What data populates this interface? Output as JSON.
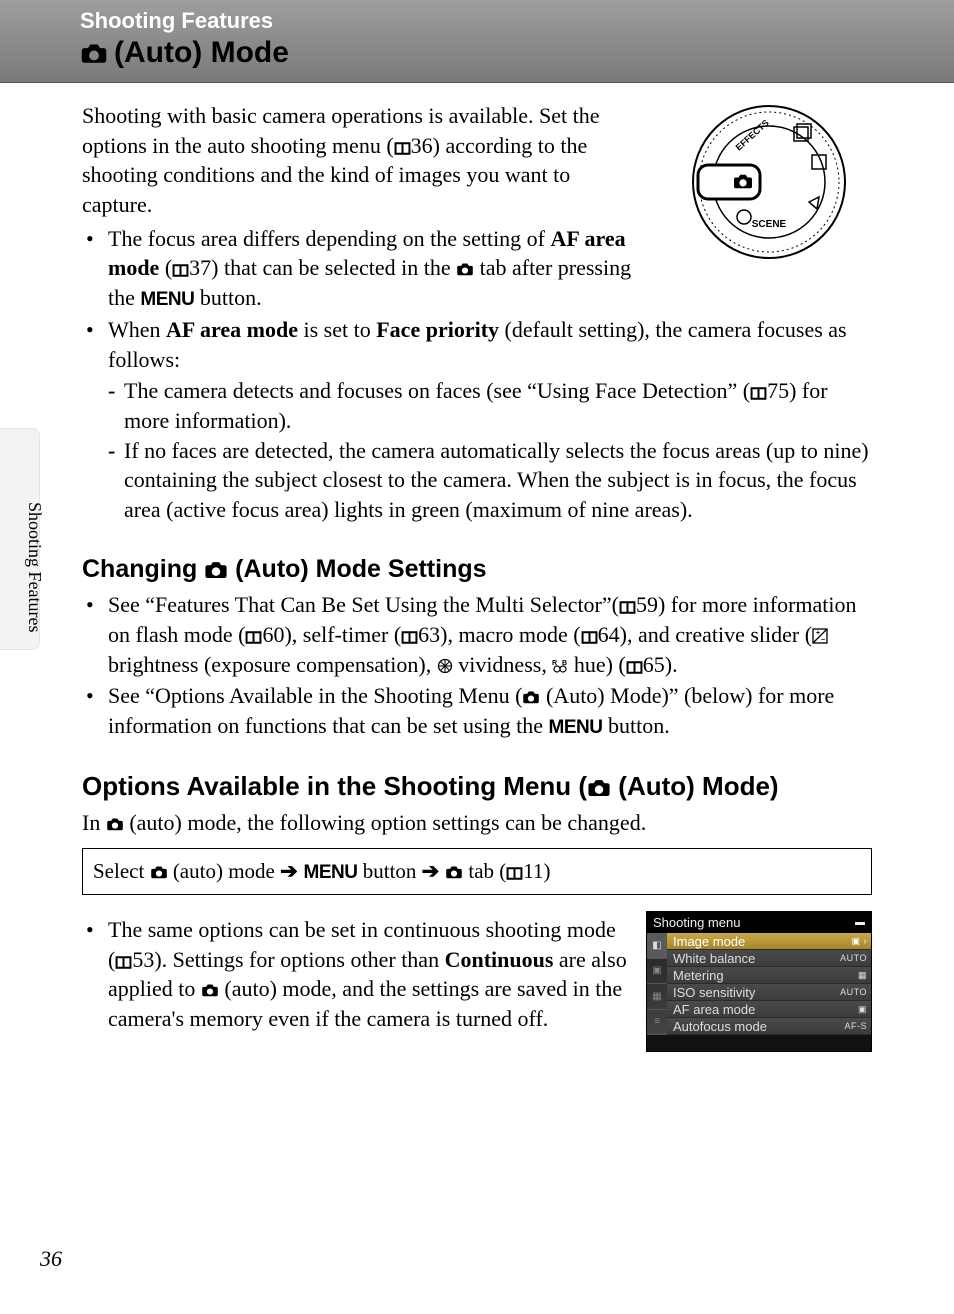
{
  "header": {
    "breadcrumb": "Shooting Features",
    "title": "(Auto) Mode"
  },
  "intro": {
    "line1_a": "Shooting with basic camera operations is available. Set the options in the auto shooting menu (",
    "ref1": "36",
    "line1_b": ") according to the shooting conditions and the kind of images you want to capture."
  },
  "bullets1": {
    "b1_a": "The focus area differs depending on the setting of ",
    "b1_bold": "AF area mode",
    "b1_b": " (",
    "b1_ref": "37",
    "b1_c": ") that can be selected in the ",
    "b1_d": " tab after pressing the ",
    "b1_menu": "MENU",
    "b1_e": " button.",
    "b2_a": "When ",
    "b2_bold1": "AF area mode",
    "b2_b": " is set to ",
    "b2_bold2": "Face priority",
    "b2_c": " (default setting), the camera focuses as follows:",
    "d1_a": "The camera detects and focuses on faces (see “Using Face Detection” (",
    "d1_ref": "75",
    "d1_b": ") for more information).",
    "d2": "If no faces are detected, the camera automatically selects  the focus areas (up to nine) containing the subject closest to the camera. When the subject is in focus, the focus area (active focus area) lights in green (maximum of nine areas)."
  },
  "sub1": {
    "pre": "Changing ",
    "post": " (Auto) Mode Settings"
  },
  "bullets2": {
    "b1_a": "See “Features That Can Be Set Using the Multi Selector”(",
    "b1_ref": "59",
    "b1_b": ") for more information on flash mode (",
    "b1_ref2": "60",
    "b1_c": "), self-timer (",
    "b1_ref3": "63",
    "b1_d": "), macro mode (",
    "b1_ref4": "64",
    "b1_e": "), and creative slider (",
    "b1_f": " brightness (exposure compensation), ",
    "b1_g": "  vividness, ",
    "b1_h": " hue) (",
    "b1_ref5": "65",
    "b1_i": ").",
    "b2_a": "See “Options Available in the Shooting Menu (",
    "b2_b": " (Auto) Mode)” (below) for more information on functions that can be set using the ",
    "b2_menu": "MENU",
    "b2_c": " button."
  },
  "sub2": {
    "pre": "Options Available in the Shooting Menu (",
    "post": " (Auto) Mode)"
  },
  "line_under_sub2_a": "In ",
  "line_under_sub2_b": " (auto) mode, the following option settings can be changed.",
  "navbox": {
    "a": "Select ",
    "b": " (auto) mode ",
    "menu": "MENU",
    "c": " button ",
    "d": " tab (",
    "ref": "11",
    "e": ")"
  },
  "bullets3": {
    "a": "The same options can be set in continuous shooting mode (",
    "ref": "53",
    "b": "). Settings for options other than ",
    "bold": "Continuous",
    "c": " are also applied to ",
    "d": " (auto) mode, and the settings are saved in the camera's memory even if the camera is turned off."
  },
  "menu_shot": {
    "title": "Shooting menu",
    "rows": [
      {
        "label": "Image mode",
        "val": "▣ ›"
      },
      {
        "label": "White balance",
        "val": "AUTO"
      },
      {
        "label": "Metering",
        "val": "▦"
      },
      {
        "label": "ISO sensitivity",
        "val": "AUTO"
      },
      {
        "label": "AF area mode",
        "val": "▣"
      },
      {
        "label": "Autofocus mode",
        "val": "AF-S"
      }
    ]
  },
  "sidebar": "Shooting Features",
  "page": "36"
}
